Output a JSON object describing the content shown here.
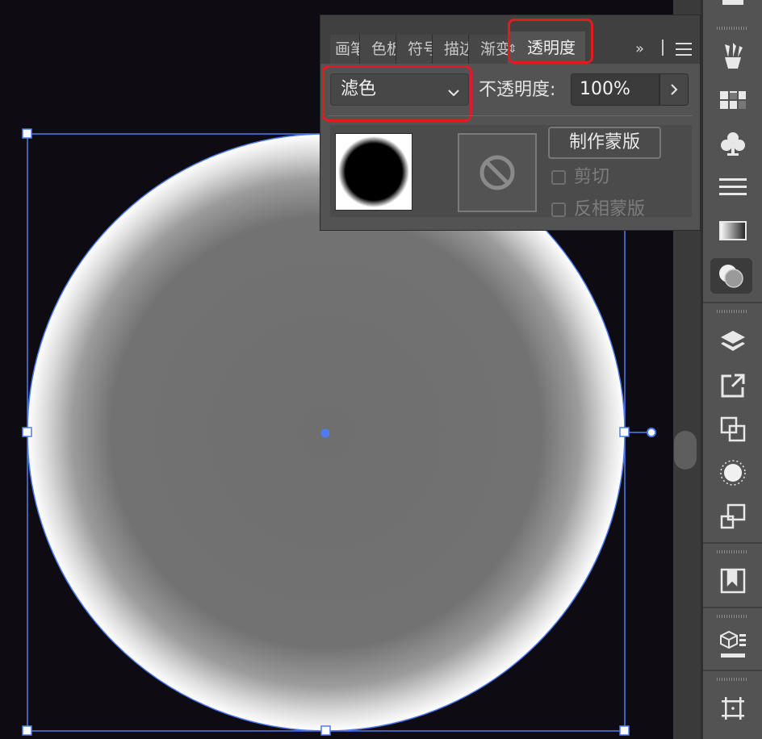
{
  "panel": {
    "tabs": [
      {
        "label": "画笔"
      },
      {
        "label": "色板"
      },
      {
        "label": "符号"
      },
      {
        "label": "描边"
      },
      {
        "label": "渐变"
      }
    ],
    "active_tab": "透明度",
    "overflow": "»",
    "blend_mode": "滤色",
    "opacity_label": "不透明度:",
    "opacity_value": "100%",
    "make_mask_label": "制作蒙版",
    "clip_label": "剪切",
    "invert_mask_label": "反相蒙版"
  },
  "colors": {
    "highlight": "#e21b22",
    "selection": "#4f7cf2",
    "panel_bg": "#535353",
    "canvas_bg": "#0e0c12"
  },
  "tools": [
    "brushes-icon",
    "swatches-icon",
    "symbols-icon",
    "stroke-icon",
    "gradient-icon",
    "transparency-icon",
    "layers-icon",
    "export-icon",
    "pathfinder-icon",
    "appearance-icon",
    "transform-icon",
    "libraries-icon",
    "3d-icon",
    "artboards-icon"
  ]
}
